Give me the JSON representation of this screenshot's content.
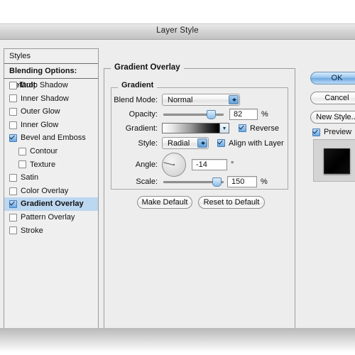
{
  "window": {
    "title": "Layer Style"
  },
  "styles_panel": {
    "header": "Styles",
    "blending_options": "Blending Options: Default",
    "effects": [
      {
        "label": "Drop Shadow",
        "checked": false,
        "sub": false,
        "selected": false
      },
      {
        "label": "Inner Shadow",
        "checked": false,
        "sub": false,
        "selected": false
      },
      {
        "label": "Outer Glow",
        "checked": false,
        "sub": false,
        "selected": false
      },
      {
        "label": "Inner Glow",
        "checked": false,
        "sub": false,
        "selected": false
      },
      {
        "label": "Bevel and Emboss",
        "checked": true,
        "sub": false,
        "selected": false
      },
      {
        "label": "Contour",
        "checked": false,
        "sub": true,
        "selected": false
      },
      {
        "label": "Texture",
        "checked": false,
        "sub": true,
        "selected": false
      },
      {
        "label": "Satin",
        "checked": false,
        "sub": false,
        "selected": false
      },
      {
        "label": "Color Overlay",
        "checked": false,
        "sub": false,
        "selected": false
      },
      {
        "label": "Gradient Overlay",
        "checked": true,
        "sub": false,
        "selected": true
      },
      {
        "label": "Pattern Overlay",
        "checked": false,
        "sub": false,
        "selected": false
      },
      {
        "label": "Stroke",
        "checked": false,
        "sub": false,
        "selected": false
      }
    ]
  },
  "main": {
    "group_title": "Gradient Overlay",
    "section_title": "Gradient",
    "blend_mode": {
      "label": "Blend Mode:",
      "value": "Normal"
    },
    "opacity": {
      "label": "Opacity:",
      "value": "82",
      "unit": "%",
      "percent": 82
    },
    "gradient": {
      "label": "Gradient:",
      "from": "#ffffff",
      "to": "#000000"
    },
    "reverse": {
      "label": "Reverse",
      "checked": true
    },
    "style": {
      "label": "Style:",
      "value": "Radial"
    },
    "align": {
      "label": "Align with Layer",
      "checked": true
    },
    "angle": {
      "label": "Angle:",
      "value": "-14",
      "unit": "°",
      "degrees": -14
    },
    "scale": {
      "label": "Scale:",
      "value": "150",
      "unit": "%",
      "percent": 93
    },
    "make_default": "Make Default",
    "reset_to_default": "Reset to Default"
  },
  "right": {
    "ok": "OK",
    "cancel": "Cancel",
    "new_style": "New Style...",
    "preview": {
      "label": "Preview",
      "checked": true
    },
    "preview_swatch_color": "#000000"
  }
}
